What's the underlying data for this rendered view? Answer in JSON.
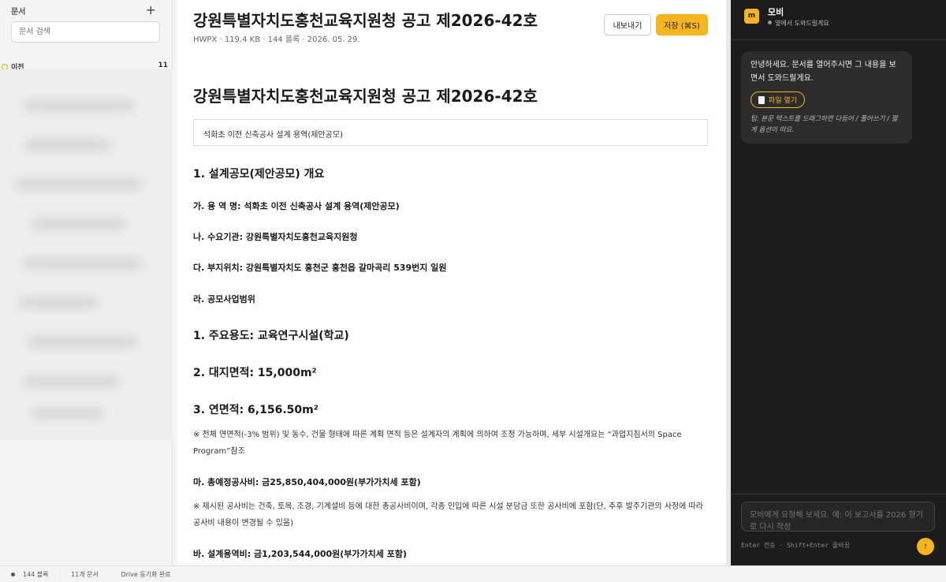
{
  "sidebar": {
    "title": "문서",
    "add_icon": "+",
    "search_placeholder": "문서 검색",
    "group": {
      "label": "이전",
      "count": "11"
    }
  },
  "document": {
    "title": "강원특별자치도홍천교육지원청 공고 제2026-42호",
    "meta": "HWPX · 119.4 KB · 144 블록 · 2026. 05. 29.",
    "export_label": "내보내기",
    "save_label": "저장 (⌘S)",
    "heading": "강원특별자치도홍천교육지원청 공고 제2026-42호",
    "boxed": "석화초 이전 신축공사 설계 용역(제안공모)",
    "sections": {
      "s1": "1. 설계공모(제안공모) 개요",
      "ga": "가. 용 역 명: 석화초 이전 신축공사 설계 용역(제안공모)",
      "na": "나. 수요기관: 강원특별자치도홍천교육지원청",
      "da": "다. 부지위치: 강원특별자치도 홍천군 홍천읍 갈마곡리 539번지 일원",
      "ra": "라. 공모사업범위",
      "u1": "1. 주요용도: 교육연구시설(학교)",
      "u2": "2. 대지면적: 15,000m²",
      "u3": "3. 연면적: 6,156.50m²",
      "note1": "※ 전체 연면적(-3% 범위) 및 동수, 건물 형태에 따른 계획 면적 등은 설계자의 계획에 의하여 조정 가능하며, 세부 시설개요는 “과업지침서의 Space Program”참조",
      "ma": "마. 총예정공사비: 금25,850,404,000원(부가가치세 포함)",
      "note2": "※ 제시된 공사비는 건축, 토목, 조경, 기계설비 등에 대한 총공사비이며, 각종 인입에 따른 시설 분담금 또한 공사비에 포함(단, 추후 발주기관의 사정에 따라 공사비 내용이 변경될 수 있음)",
      "ba": "바. 설계용역비: 금1,203,544,000원(부가가치세 포함)"
    }
  },
  "chat": {
    "avatar": "m",
    "name": "모비",
    "status": "옆에서 도와드릴게요",
    "greeting": "안녕하세요. 문서를 열어주시면 그 내용을 보면서 도와드릴게요.",
    "open_file_label": "파일 열기",
    "tip": "팁: 본문 텍스트를 드래그하면 다듬어 / 풀어쓰기 / 짧게 옵션이 떠요.",
    "input_placeholder": "모비에게 요청해 보세요. 예: 이 보고서를 2026 향기로 다시 작성",
    "hint": "Enter 전송 · Shift+Enter 줄바꿈",
    "send_icon": "↑"
  },
  "status": {
    "blocks": "144 블록",
    "docs": "11개 문서",
    "sync": "Drive 동기화 완료"
  },
  "colors": {
    "accent": "#f6b51d",
    "chat_bg": "#1c1c1c"
  }
}
